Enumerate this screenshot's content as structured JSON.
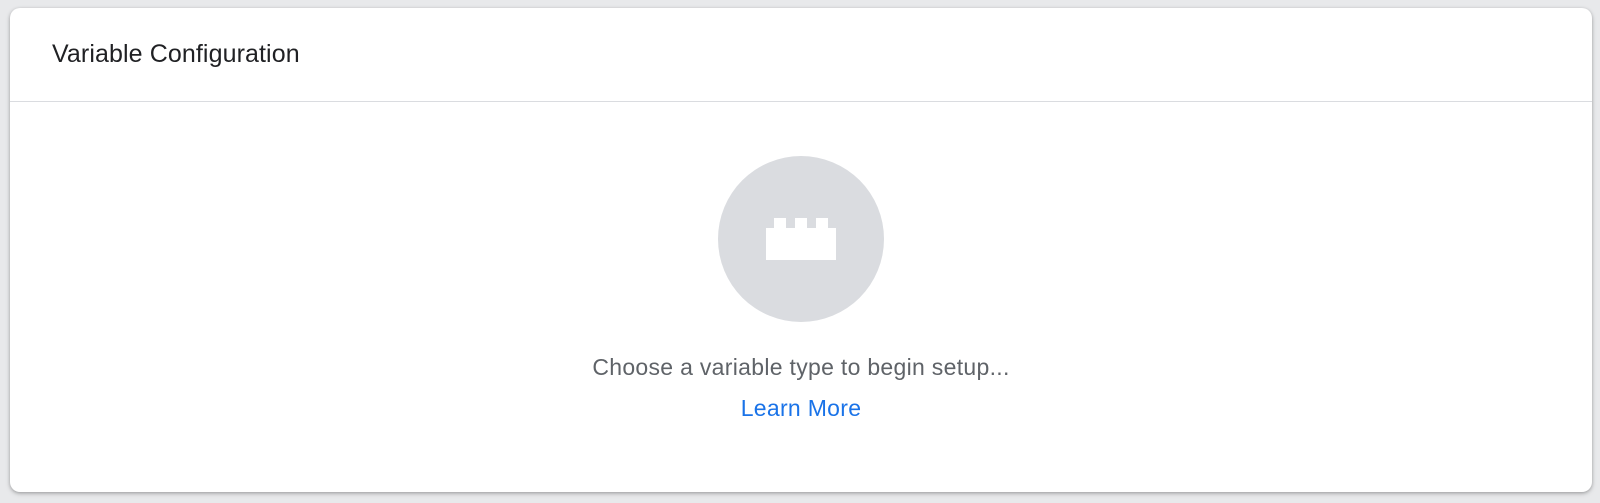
{
  "panel": {
    "title": "Variable Configuration"
  },
  "empty_state": {
    "icon": "lego-brick-icon",
    "message": "Choose a variable type to begin setup...",
    "link_label": "Learn More"
  },
  "colors": {
    "link": "#1a73e8",
    "icon_circle": "#dadce0",
    "message_text": "#5f6368"
  }
}
